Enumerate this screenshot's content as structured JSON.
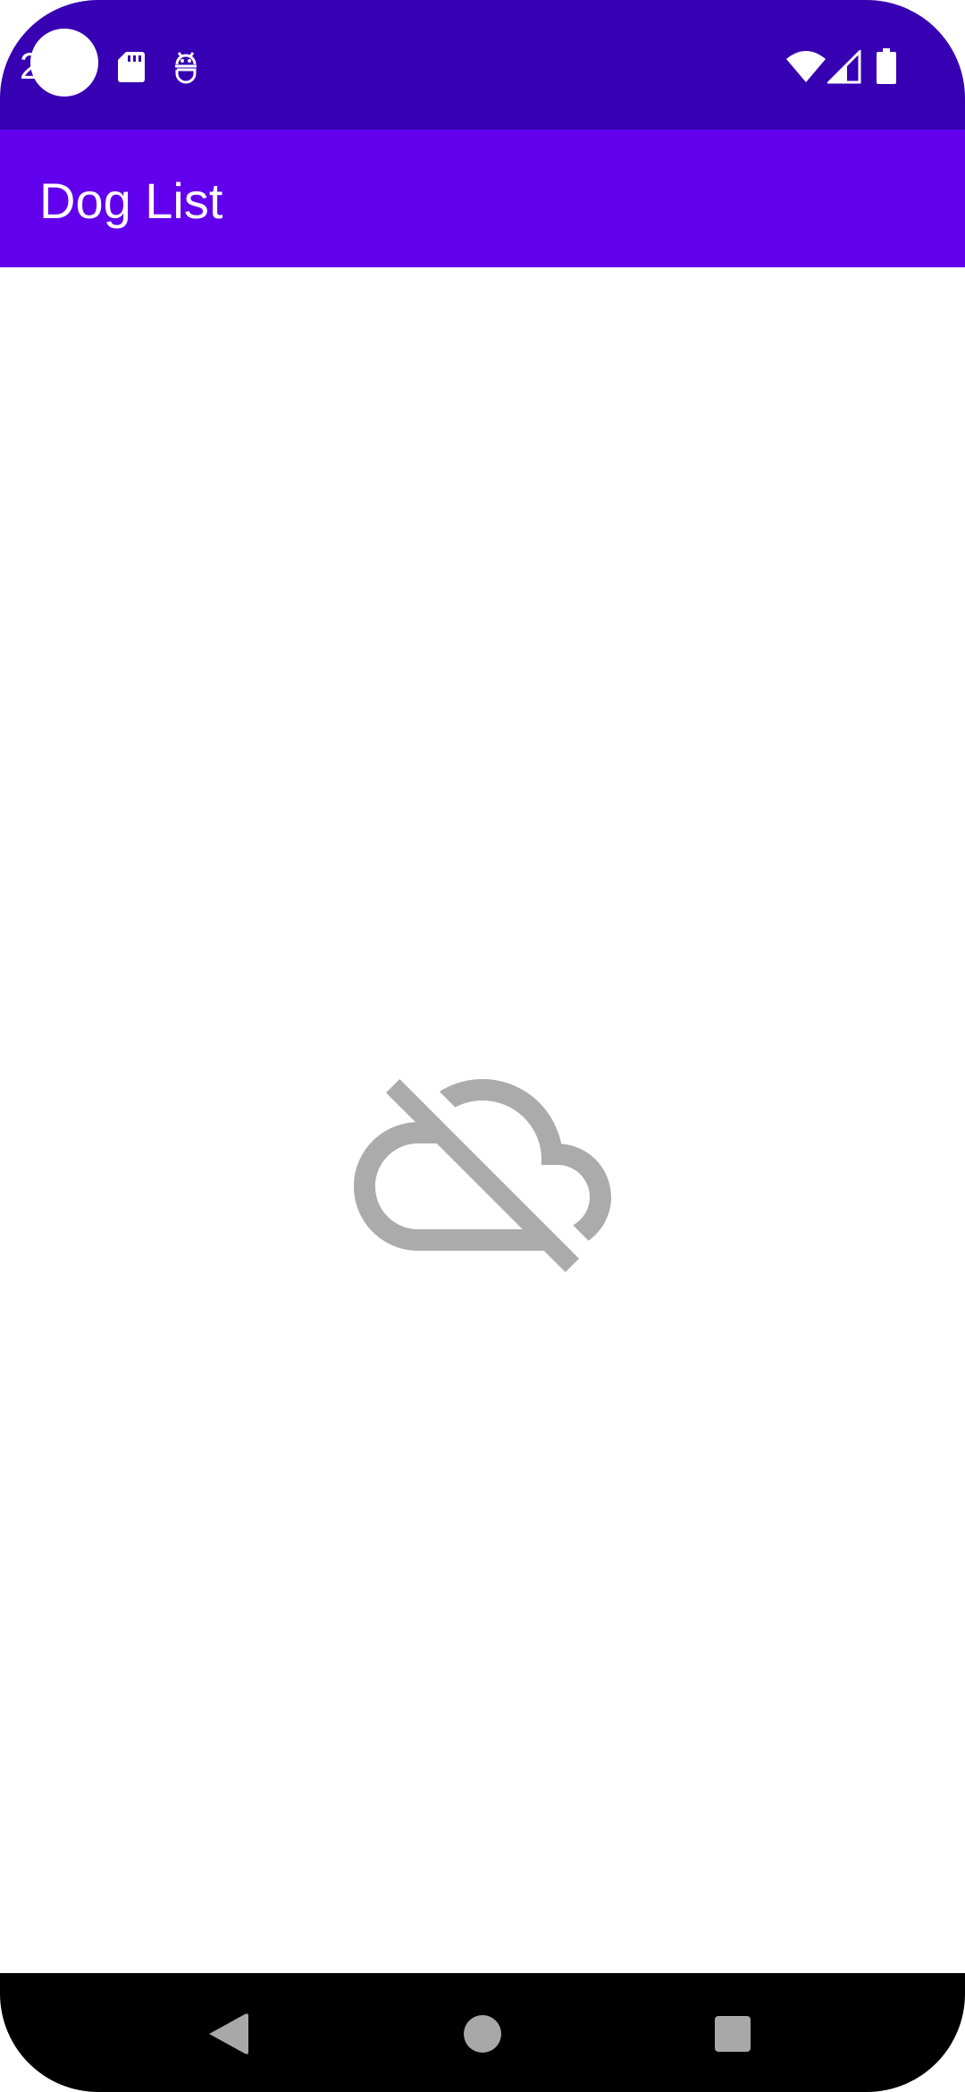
{
  "status_bar": {
    "time": "2",
    "icons": [
      "sd-card-icon",
      "android-debug-icon",
      "wifi-icon",
      "signal-icon",
      "battery-icon"
    ],
    "background_color": "#3700B3"
  },
  "app_bar": {
    "title": "Dog List",
    "background_color": "#6200EE"
  },
  "content": {
    "state_icon": "cloud-off-icon",
    "icon_color": "#ABABAB"
  },
  "nav_bar": {
    "buttons": [
      "back-icon",
      "home-icon",
      "recents-icon"
    ]
  }
}
